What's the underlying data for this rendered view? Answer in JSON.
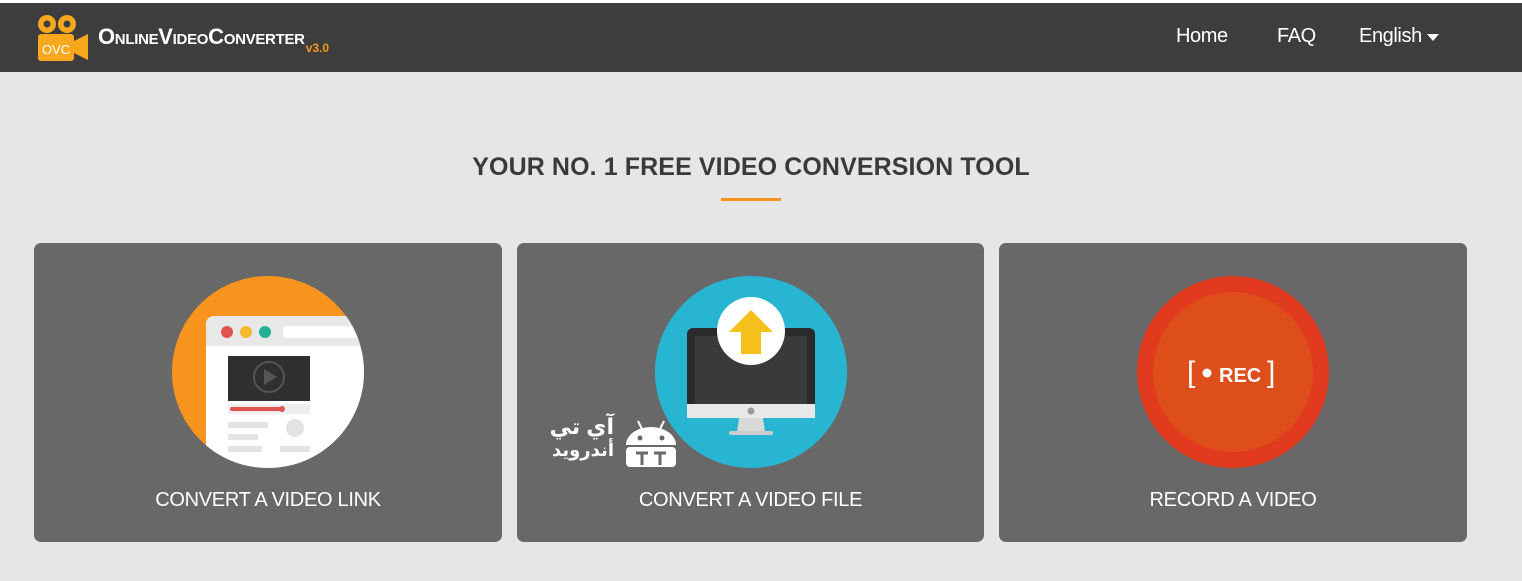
{
  "colors": {
    "navbar_bg": "#3d3d3d",
    "page_bg": "#e6e6e6",
    "card_bg": "#686868",
    "accent_orange": "#f7941d",
    "upload_blue": "#27b5d2",
    "rec_red": "#e23a1f"
  },
  "header": {
    "logo_badge": "OVC",
    "brand": "OnlineVideoConverter",
    "version": "v3.0",
    "nav": {
      "home": "Home",
      "faq": "FAQ",
      "language": "English"
    }
  },
  "main": {
    "headline": "YOUR NO. 1 FREE VIDEO CONVERSION TOOL",
    "cards": [
      {
        "label": "CONVERT A VIDEO LINK",
        "icon": "browser-video-icon"
      },
      {
        "label": "CONVERT A VIDEO FILE",
        "icon": "monitor-upload-icon"
      },
      {
        "label": "RECORD A VIDEO",
        "icon": "record-icon",
        "rec_text": "REC"
      }
    ]
  },
  "watermark": {
    "line1": "آي تي",
    "line2": "أندرويد",
    "icon": "android-robot-icon"
  }
}
